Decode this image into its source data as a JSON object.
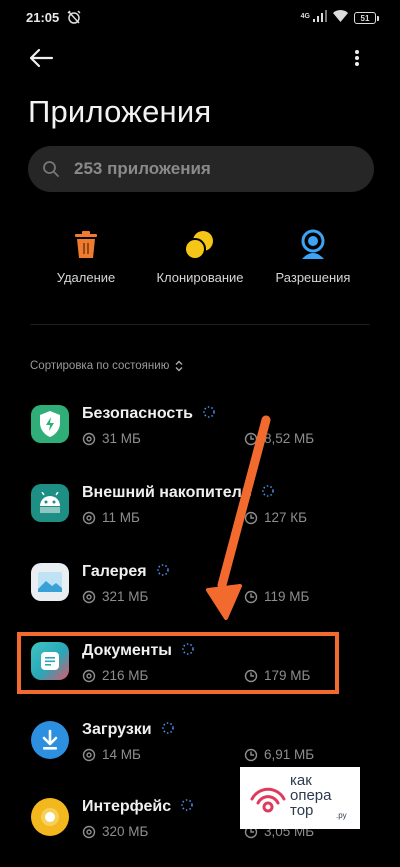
{
  "status_bar": {
    "time": "21:05",
    "network": "4G",
    "battery": "51"
  },
  "page": {
    "title": "Приложения"
  },
  "search": {
    "placeholder": "253 приложения"
  },
  "actions": [
    {
      "label": "Удаление",
      "icon": "trash-icon",
      "color": "#f07a2e"
    },
    {
      "label": "Клонирование",
      "icon": "clone-icon",
      "color": "#f5c518"
    },
    {
      "label": "Разрешения",
      "icon": "permissions-icon",
      "color": "#3da3f5"
    }
  ],
  "sort": {
    "label": "Сортировка по состоянию"
  },
  "apps": [
    {
      "name": "Безопасность",
      "size": "31 МБ",
      "cache": "8,52 МБ",
      "icon": "shield-icon"
    },
    {
      "name": "Внешний накопитель",
      "size": "11 МБ",
      "cache": "127 КБ",
      "icon": "android-icon"
    },
    {
      "name": "Галерея",
      "size": "321 МБ",
      "cache": "119 МБ",
      "icon": "gallery-icon"
    },
    {
      "name": "Документы",
      "size": "216 МБ",
      "cache": "179 МБ",
      "icon": "documents-icon"
    },
    {
      "name": "Загрузки",
      "size": "14 МБ",
      "cache": "6,91 МБ",
      "icon": "download-icon"
    },
    {
      "name": "Интерфейс",
      "size": "320 МБ",
      "cache": "3,05 МБ",
      "icon": "interface-icon"
    }
  ],
  "watermark": {
    "line1": "как",
    "line2": "опера",
    "line3": "тор",
    "suffix": ".ру"
  },
  "colors": {
    "accent_orange": "#f26a2e",
    "background": "#000000"
  }
}
